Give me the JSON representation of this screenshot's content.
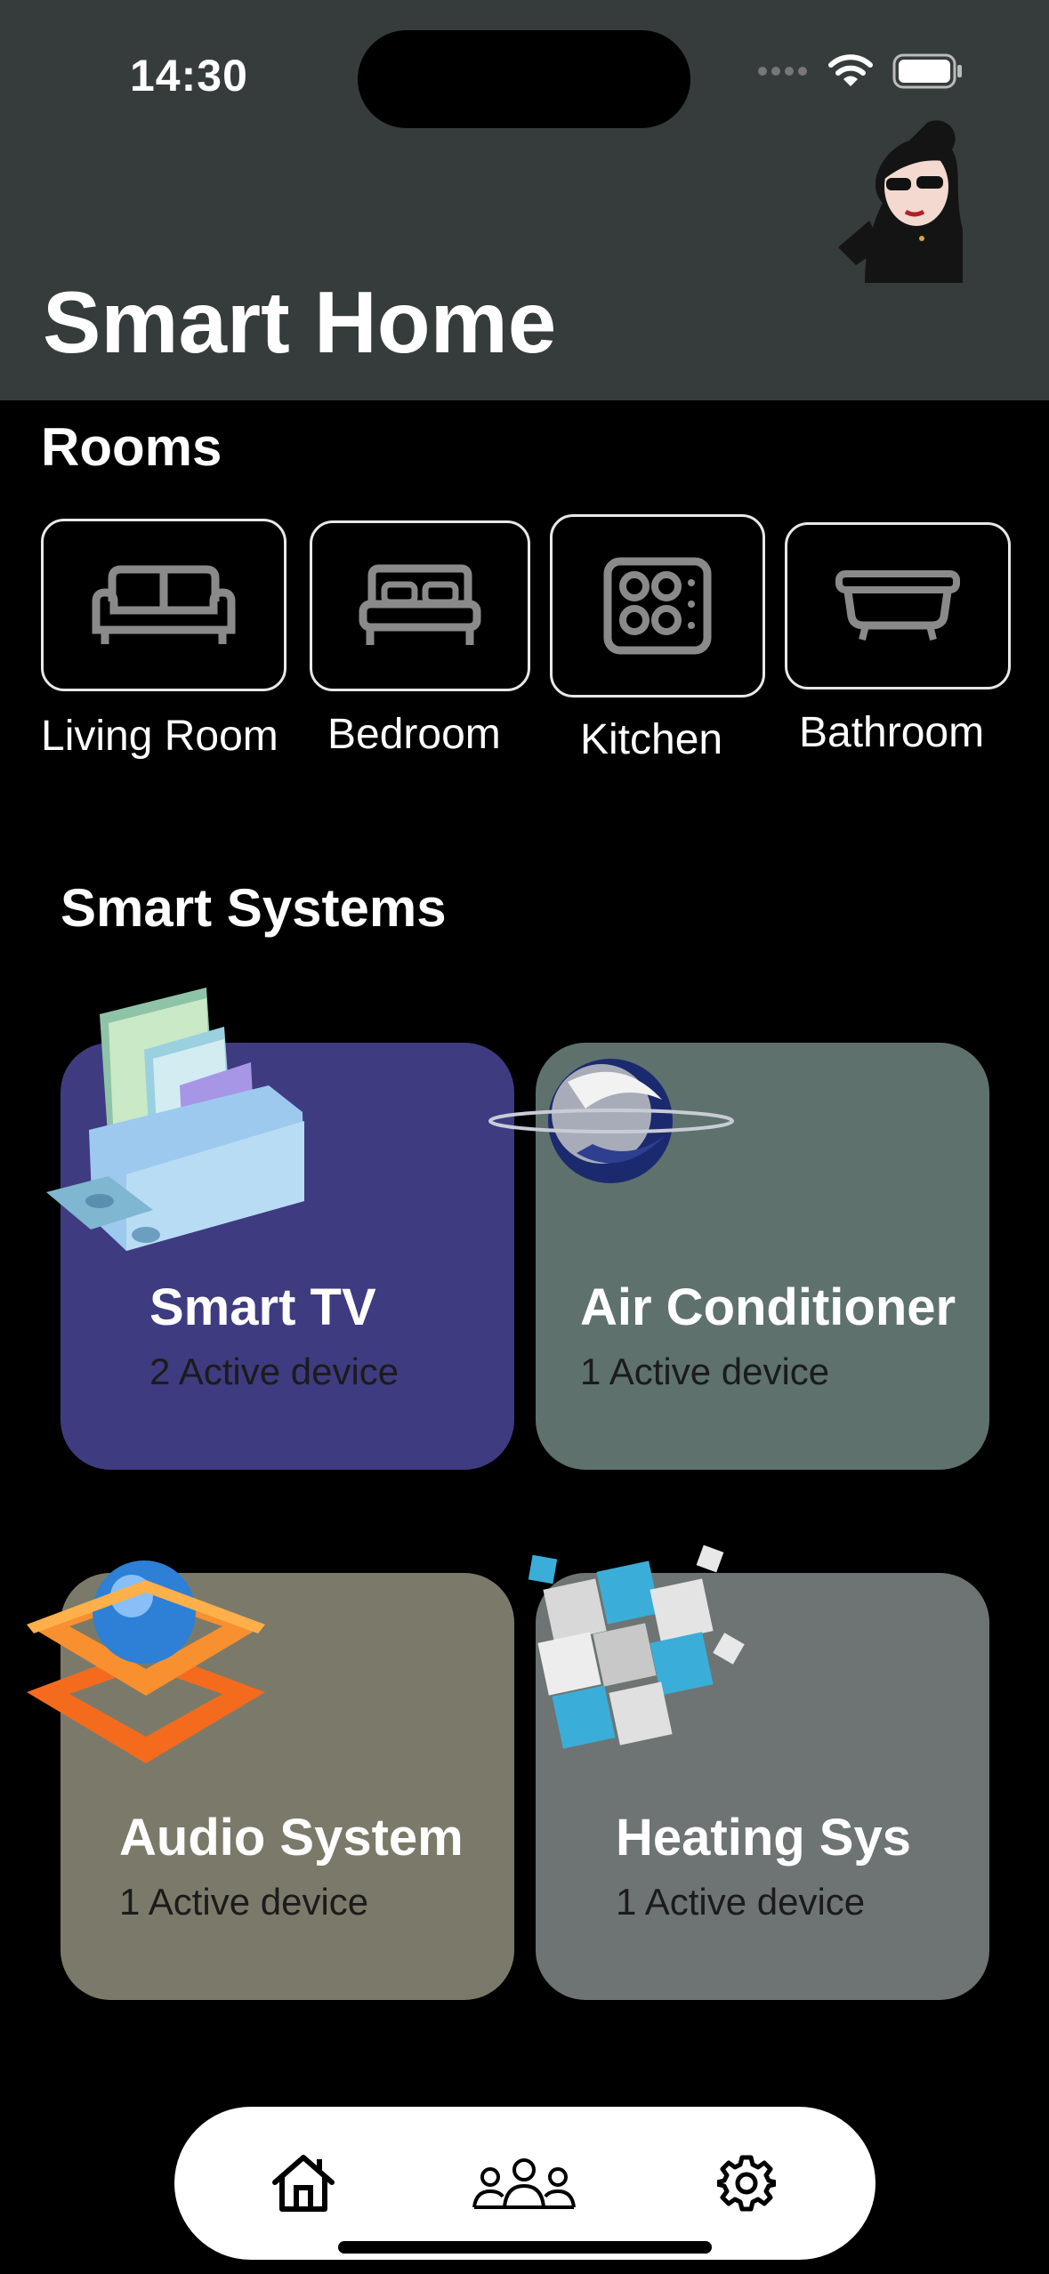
{
  "status_bar": {
    "time": "14:30"
  },
  "header": {
    "title": "Smart Home",
    "avatar_icon": "avatar-icon"
  },
  "rooms": {
    "title": "Rooms",
    "items": [
      {
        "label": "Living Room",
        "icon": "sofa-icon"
      },
      {
        "label": "Bedroom",
        "icon": "bed-icon"
      },
      {
        "label": "Kitchen",
        "icon": "stove-icon"
      },
      {
        "label": "Bathroom",
        "icon": "bathtub-icon"
      }
    ]
  },
  "systems": {
    "title": "Smart Systems",
    "items": [
      {
        "name": "Smart TV",
        "status": "2 Active device",
        "color": "#3f3b80",
        "icon": "books-box-icon"
      },
      {
        "name": "Air Conditioner",
        "status": "1 Active device",
        "color": "#5e716d",
        "icon": "planet-ring-icon"
      },
      {
        "name": "Audio System",
        "status": "1 Active device",
        "color": "#7b7a6a",
        "icon": "stacked-frames-icon"
      },
      {
        "name": "Heating Sys",
        "status": "1 Active device",
        "color": "#6d7473",
        "icon": "cube-blocks-icon"
      }
    ]
  },
  "tab_bar": {
    "items": [
      {
        "icon": "home-icon"
      },
      {
        "icon": "people-icon"
      },
      {
        "icon": "gear-icon"
      }
    ]
  }
}
